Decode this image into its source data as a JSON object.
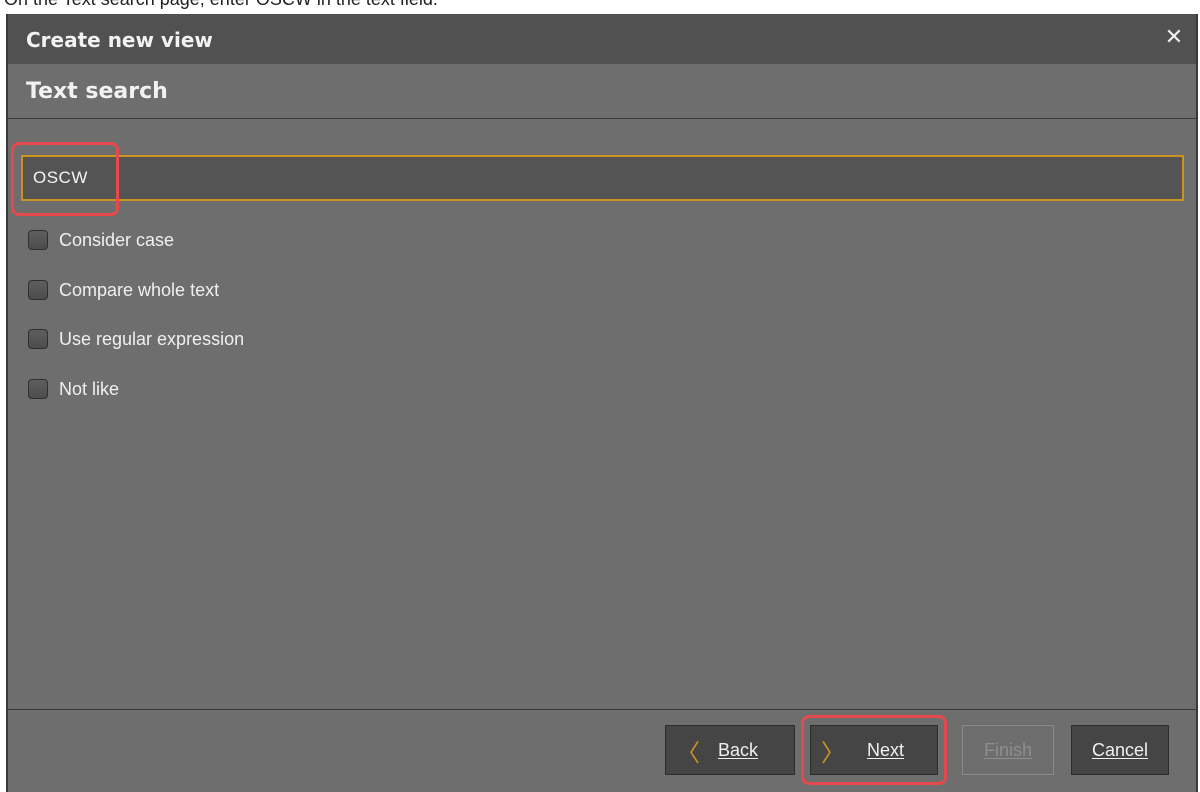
{
  "caption": "On the Text search page, enter OSCW in the text field.",
  "dialog": {
    "title": "Create new view",
    "close_symbol": "✕",
    "page_title": "Text search"
  },
  "search": {
    "value": "OSCW",
    "placeholder": ""
  },
  "options": [
    {
      "label": "Consider case",
      "checked": false
    },
    {
      "label": "Compare whole text",
      "checked": false
    },
    {
      "label": "Use regular expression",
      "checked": false
    },
    {
      "label": "Not like",
      "checked": false
    }
  ],
  "buttons": {
    "back": {
      "label": "Back",
      "icon": "chevron-left-icon",
      "glyph": "〈"
    },
    "next": {
      "label": "Next",
      "icon": "chevron-right-icon",
      "glyph": "〉"
    },
    "finish": {
      "label": "Finish",
      "enabled": false
    },
    "cancel": {
      "label": "Cancel"
    }
  },
  "colors": {
    "accent": "#c8941e",
    "highlight": "#e5484d",
    "dialog_background": "#6e6e6e",
    "titlebar": "#515151"
  }
}
